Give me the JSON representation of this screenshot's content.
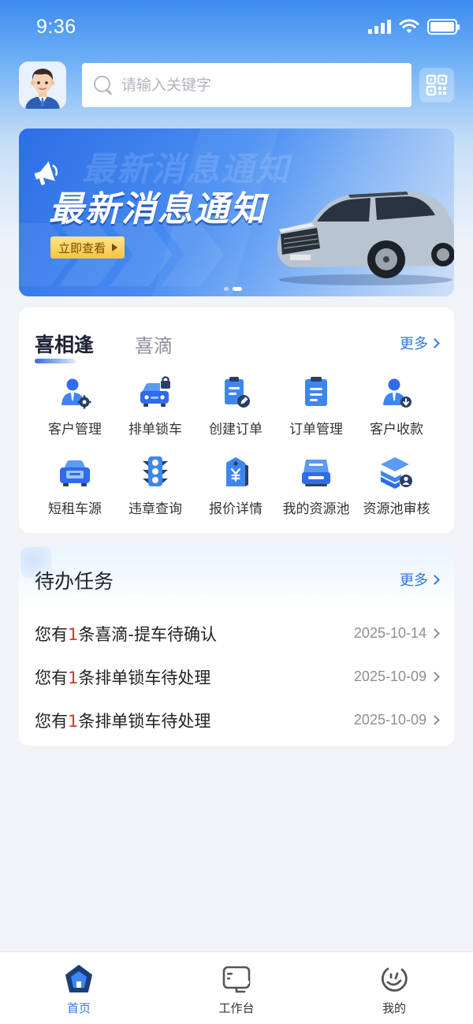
{
  "status_bar": {
    "time": "9:36"
  },
  "search": {
    "placeholder": "请输入关键字"
  },
  "banner": {
    "title": "最新消息通知",
    "cta_label": "立即查看",
    "page_count": 2,
    "active_page": 2
  },
  "services": {
    "tabs": [
      {
        "label": "喜相逢",
        "active": true
      },
      {
        "label": "喜滴",
        "active": false
      }
    ],
    "more_label": "更多",
    "items": [
      {
        "label": "客户管理",
        "icon": "customer-manage-icon"
      },
      {
        "label": "排单锁车",
        "icon": "car-lock-icon"
      },
      {
        "label": "创建订单",
        "icon": "create-order-icon"
      },
      {
        "label": "订单管理",
        "icon": "order-manage-icon"
      },
      {
        "label": "客户收款",
        "icon": "customer-payment-icon"
      },
      {
        "label": "短租车源",
        "icon": "short-rent-car-icon"
      },
      {
        "label": "违章查询",
        "icon": "traffic-light-icon"
      },
      {
        "label": "报价详情",
        "icon": "price-tag-icon"
      },
      {
        "label": "我的资源池",
        "icon": "resource-pool-icon"
      },
      {
        "label": "资源池审核",
        "icon": "resource-audit-icon"
      }
    ]
  },
  "tasks": {
    "title": "待办任务",
    "more_label": "更多",
    "items": [
      {
        "prefix": "您有",
        "count": "1",
        "suffix": "条喜滴-提车待确认",
        "date": "2025-10-14"
      },
      {
        "prefix": "您有",
        "count": "1",
        "suffix": "条排单锁车待处理",
        "date": "2025-10-09"
      },
      {
        "prefix": "您有",
        "count": "1",
        "suffix": "条排单锁车待处理",
        "date": "2025-10-09"
      }
    ]
  },
  "tabbar": {
    "items": [
      {
        "label": "首页",
        "icon": "home-icon",
        "active": true
      },
      {
        "label": "工作台",
        "icon": "workbench-icon",
        "active": false
      },
      {
        "label": "我的",
        "icon": "profile-icon",
        "active": false
      }
    ]
  },
  "colors": {
    "accent": "#2f78e4",
    "highlight_number": "#e03131",
    "icon_blue": "#2f6bea"
  }
}
